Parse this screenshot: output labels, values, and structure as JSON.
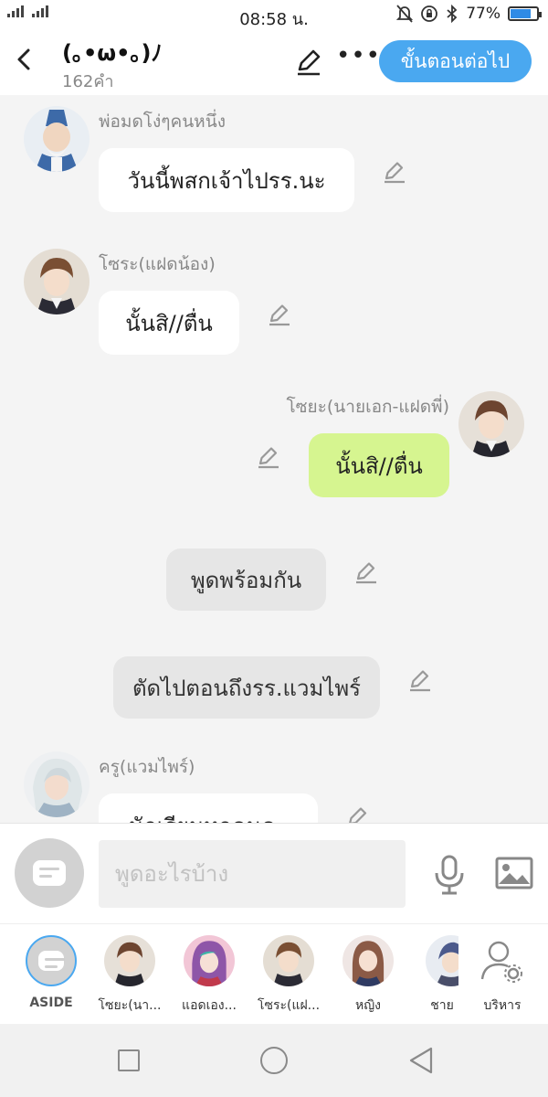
{
  "status_bar": {
    "signal": "H+ 3G",
    "time": "08:58 น.",
    "battery": "77%",
    "battery_level": 0.77
  },
  "header": {
    "title": "(｡•ω•｡)ﾉ",
    "word_count": "162คำ",
    "next_button": "ขั้นตอนต่อไป"
  },
  "messages": [
    {
      "speaker": "พ่อมดโง่ๆคนหนึ่ง",
      "text": "วันนี้พสกเจ้าไปรร.นะ"
    },
    {
      "speaker": "โซระ(แฝดน้อง)",
      "text": "นั้นสิ//ตื่น"
    },
    {
      "speaker": "โซยะ(นายเอก-แฝดพี่)",
      "text": "นั้นสิ//ตื่น"
    },
    {
      "speaker": "",
      "text": "พูดพร้อมกัน"
    },
    {
      "speaker": "",
      "text": "ตัดไปตอนถึงรร.แวมไพร์"
    },
    {
      "speaker": "ครู(แวมไพร์)",
      "text": "นักเรียนทุกคนคะ"
    }
  ],
  "input": {
    "placeholder": "พูดอะไรบ้าง"
  },
  "characters": [
    {
      "label": "ASIDE"
    },
    {
      "label": "โซยะ(นา..."
    },
    {
      "label": "แอดเอง..."
    },
    {
      "label": "โซระ(แฝ..."
    },
    {
      "label": "หญิง"
    },
    {
      "label": "ชาย"
    },
    {
      "label": "บริหาร"
    }
  ],
  "colors": {
    "accent": "#4aa8f0",
    "my_bubble": "#d6f590",
    "system_bubble": "#e6e6e6"
  }
}
